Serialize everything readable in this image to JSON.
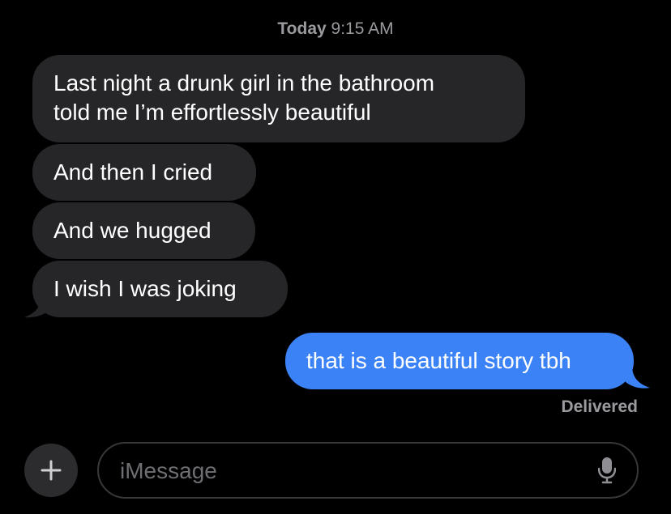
{
  "header": {
    "timestamp_day": "Today",
    "timestamp_time": "9:15 AM"
  },
  "messages": {
    "incoming": [
      {
        "line1": "Last night a drunk girl in the bathroom",
        "line2": "told me I’m effortlessly beautiful"
      },
      {
        "text": "And then I cried"
      },
      {
        "text": "And we hugged"
      },
      {
        "text": "I wish I was joking"
      }
    ],
    "outgoing": [
      {
        "text": "that is a beautiful story tbh"
      }
    ],
    "delivered_label": "Delivered"
  },
  "composer": {
    "placeholder": "iMessage",
    "plus_icon": "plus-icon",
    "mic_icon": "microphone-icon"
  },
  "colors": {
    "background": "#000000",
    "incoming_bubble": "#262629",
    "outgoing_bubble": "#3b82f6",
    "meta_text": "#9a9a9f"
  }
}
